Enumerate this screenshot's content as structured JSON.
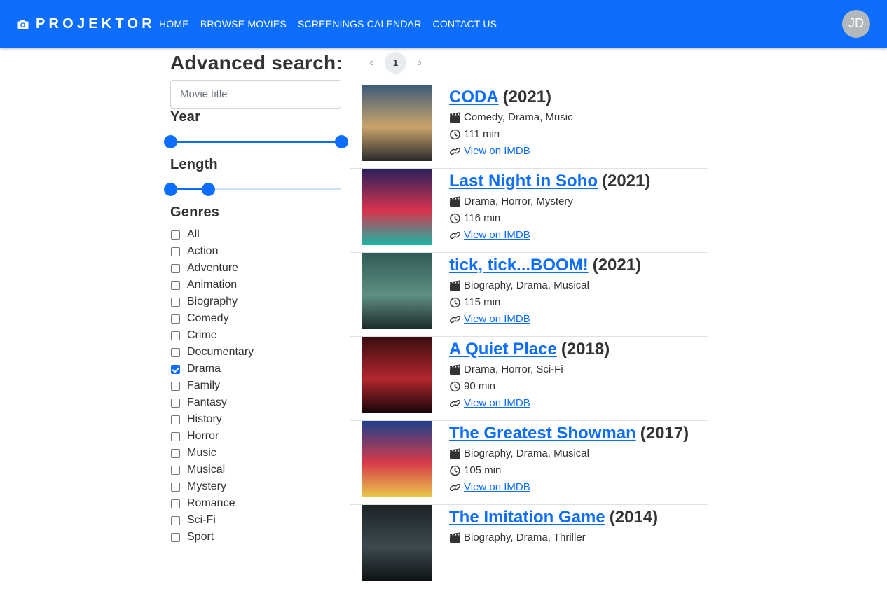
{
  "brand": "PROJEKTOR",
  "nav": [
    "HOME",
    "BROWSE MOVIES",
    "SCREENINGS CALENDAR",
    "CONTACT US"
  ],
  "user_initials": "JD",
  "search": {
    "title": "Advanced search:",
    "placeholder": "Movie title",
    "year_label": "Year",
    "year_range_fraction": [
      0.0,
      1.0
    ],
    "length_label": "Length",
    "length_range_fraction": [
      0.0,
      0.22
    ],
    "genres_label": "Genres",
    "genres": [
      {
        "name": "All",
        "checked": false
      },
      {
        "name": "Action",
        "checked": false
      },
      {
        "name": "Adventure",
        "checked": false
      },
      {
        "name": "Animation",
        "checked": false
      },
      {
        "name": "Biography",
        "checked": false
      },
      {
        "name": "Comedy",
        "checked": false
      },
      {
        "name": "Crime",
        "checked": false
      },
      {
        "name": "Documentary",
        "checked": false
      },
      {
        "name": "Drama",
        "checked": true
      },
      {
        "name": "Family",
        "checked": false
      },
      {
        "name": "Fantasy",
        "checked": false
      },
      {
        "name": "History",
        "checked": false
      },
      {
        "name": "Horror",
        "checked": false
      },
      {
        "name": "Music",
        "checked": false
      },
      {
        "name": "Musical",
        "checked": false
      },
      {
        "name": "Mystery",
        "checked": false
      },
      {
        "name": "Romance",
        "checked": false
      },
      {
        "name": "Sci-Fi",
        "checked": false
      },
      {
        "name": "Sport",
        "checked": false
      }
    ]
  },
  "pagination": {
    "current": "1",
    "prev_icon": "chevron-left-icon",
    "next_icon": "chevron-right-icon"
  },
  "imdb_link_text": "View on IMDB",
  "movies": [
    {
      "title": "CODA",
      "year": "(2021)",
      "genres": "Comedy, Drama, Music",
      "length": "111 min",
      "poster_colors": [
        "#3d5a7a",
        "#c9a46b",
        "#2a2a2a"
      ]
    },
    {
      "title": "Last Night in Soho",
      "year": "(2021)",
      "genres": "Drama, Horror, Mystery",
      "length": "116 min",
      "poster_colors": [
        "#2a1f5c",
        "#d8344f",
        "#1bb5a3"
      ]
    },
    {
      "title": "tick, tick...BOOM!",
      "year": "(2021)",
      "genres": "Biography, Drama, Musical",
      "length": "115 min",
      "poster_colors": [
        "#2f5a55",
        "#5e8f83",
        "#1c2b2a"
      ]
    },
    {
      "title": "A Quiet Place",
      "year": "(2018)",
      "genres": "Drama, Horror, Sci-Fi",
      "length": "90 min",
      "poster_colors": [
        "#3a0d10",
        "#b3262e",
        "#150506"
      ]
    },
    {
      "title": "The Greatest Showman",
      "year": "(2017)",
      "genres": "Biography, Drama, Musical",
      "length": "105 min",
      "poster_colors": [
        "#1e3f8a",
        "#d83a4a",
        "#e8c84a"
      ]
    },
    {
      "title": "The Imitation Game",
      "year": "(2014)",
      "genres": "Biography, Drama, Thriller",
      "length": "",
      "poster_colors": [
        "#1b2326",
        "#3c4a4f",
        "#0e1214"
      ]
    }
  ],
  "colors": {
    "primary": "#0d6efd",
    "avatar": "#b3b8bd"
  }
}
